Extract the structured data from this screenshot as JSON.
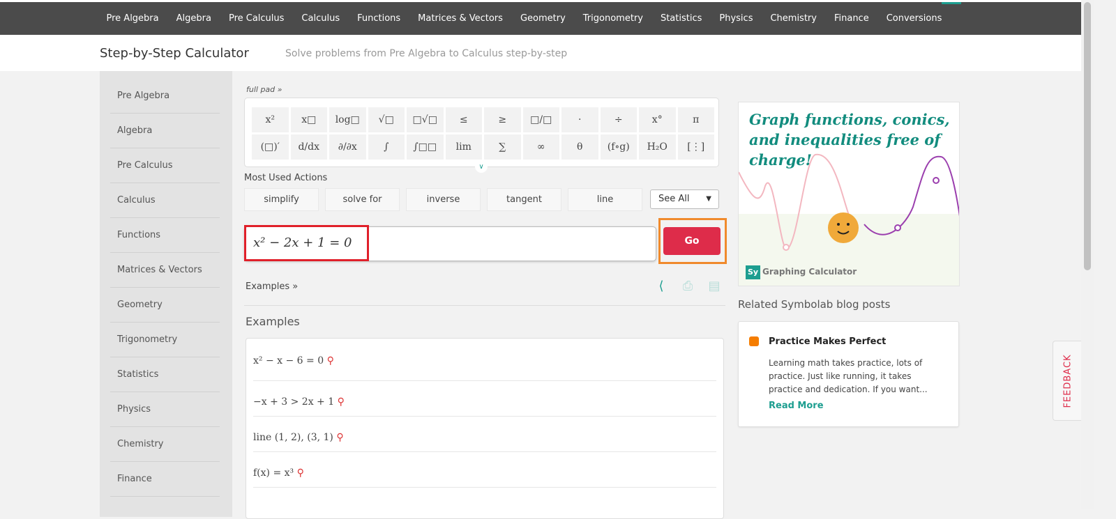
{
  "nav": {
    "items": [
      "Pre Algebra",
      "Algebra",
      "Pre Calculus",
      "Calculus",
      "Functions",
      "Matrices & Vectors",
      "Geometry",
      "Trigonometry",
      "Statistics",
      "Physics",
      "Chemistry",
      "Finance",
      "Conversions"
    ]
  },
  "header": {
    "title": "Step-by-Step Calculator",
    "subtitle": "Solve problems from Pre Algebra to Calculus step-by-step"
  },
  "sidebar": {
    "items": [
      "Pre Algebra",
      "Algebra",
      "Pre Calculus",
      "Calculus",
      "Functions",
      "Matrices & Vectors",
      "Geometry",
      "Trigonometry",
      "Statistics",
      "Physics",
      "Chemistry",
      "Finance"
    ]
  },
  "pad": {
    "full_pad": "full pad »",
    "keys": [
      "x²",
      "x□",
      "log□",
      "√□",
      "□√□",
      "≤",
      "≥",
      "□/□",
      "·",
      "÷",
      "x°",
      "π",
      "(□)′",
      "d/dx",
      "∂/∂x",
      "∫",
      "∫□□",
      "lim",
      "∑",
      "∞",
      "θ",
      "(f∘g)",
      "H₂O",
      "[⋮]"
    ]
  },
  "actions": {
    "title": "Most Used Actions",
    "items": [
      "simplify",
      "solve for",
      "inverse",
      "tangent",
      "line"
    ],
    "see_all": "See All"
  },
  "input": {
    "value": "x² − 2x + 1 = 0"
  },
  "go_label": "Go",
  "examples_link": "Examples »",
  "examples": {
    "title": "Examples",
    "items": [
      "x² − x − 6 = 0",
      "−x + 3 > 2x + 1",
      "line (1, 2), (3, 1)",
      "f(x) = x³"
    ]
  },
  "ad": {
    "headline": "Graph functions, conics, and inequalities free of charge!",
    "logo": "Sy",
    "brand": "Graphing Calculator"
  },
  "related": {
    "title": "Related Symbolab blog posts",
    "post": {
      "title": "Practice Makes Perfect",
      "excerpt": "Learning math takes practice, lots of practice. Just like running, it takes practice and dedication. If you want...",
      "read_more": "Read More"
    }
  },
  "feedback": "FEEDBACK",
  "colors": {
    "accent": "#1d9e90",
    "go": "#de2c4a",
    "nav": "#4b4b4b"
  }
}
